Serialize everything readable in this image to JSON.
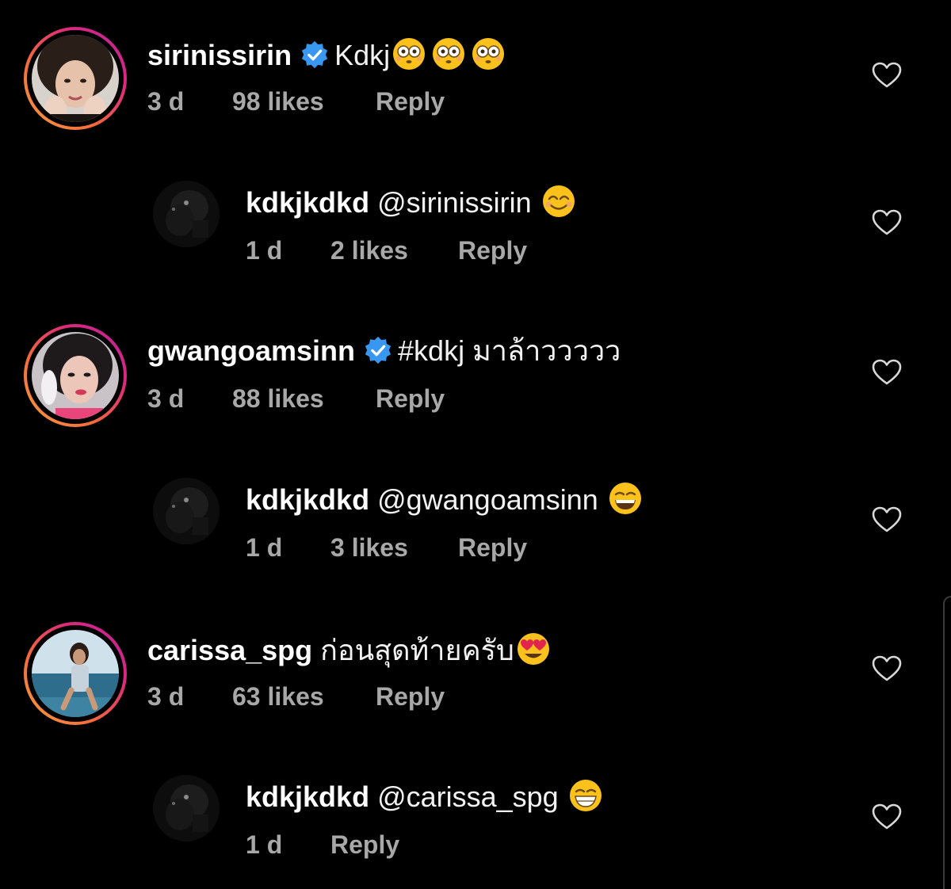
{
  "comments": [
    {
      "username": "sirinissirin",
      "verified": true,
      "text": "Kdkj",
      "emojis": [
        "flushed",
        "flushed",
        "flushed"
      ],
      "age": "3 d",
      "likes": "98 likes",
      "reply_label": "Reply",
      "avatar": "woman-portrait-photo"
    },
    {
      "username": "kdkjkdkd",
      "verified": false,
      "text": "@sirinissirin",
      "emojis": [
        "smiling-eyes"
      ],
      "age": "1 d",
      "likes": "2 likes",
      "reply_label": "Reply",
      "avatar": "dark-photo"
    },
    {
      "username": "gwangoamsinn",
      "verified": true,
      "text": "#kdkj มาล้าววววว",
      "emojis": [],
      "age": "3 d",
      "likes": "88 likes",
      "reply_label": "Reply",
      "avatar": "woman-portrait-photo"
    },
    {
      "username": "kdkjkdkd",
      "verified": false,
      "text": "@gwangoamsinn",
      "emojis": [
        "grinning-squint"
      ],
      "age": "1 d",
      "likes": "3 likes",
      "reply_label": "Reply",
      "avatar": "dark-photo"
    },
    {
      "username": "carissa_spg",
      "verified": false,
      "text": "ก่อนสุดท้ายครับ",
      "emojis": [
        "heart-eyes"
      ],
      "age": "3 d",
      "likes": "63 likes",
      "reply_label": "Reply",
      "avatar": "beach-photo"
    },
    {
      "username": "kdkjkdkd",
      "verified": false,
      "text": "@carissa_spg",
      "emojis": [
        "beaming-grin"
      ],
      "age": "1 d",
      "likes": "",
      "reply_label": "Reply",
      "avatar": "dark-photo"
    }
  ],
  "icons": {
    "like": "heart-outline-icon",
    "verified": "verified-badge-icon"
  },
  "colors": {
    "background": "#000000",
    "username": "#ffffff",
    "meta": "#a8a8a8",
    "verified": "#3897f0",
    "heart": "#d8d8d8"
  }
}
